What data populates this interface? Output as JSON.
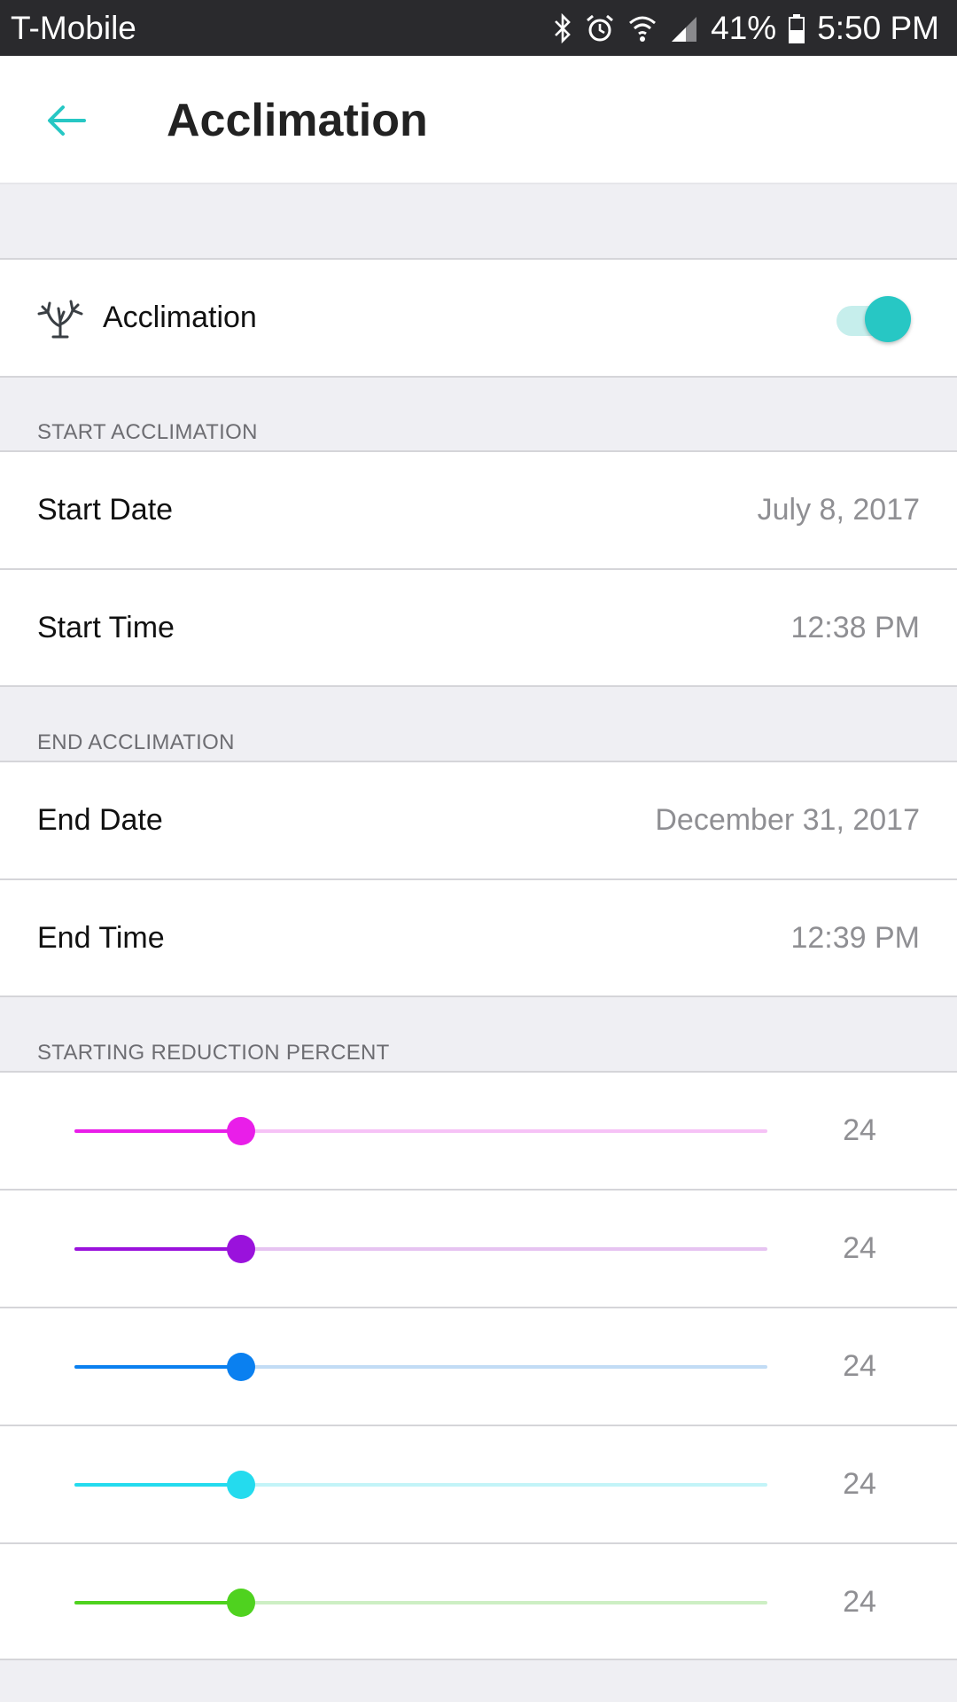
{
  "status_bar": {
    "carrier": "T-Mobile",
    "battery": "41%",
    "time": "5:50 PM",
    "icons": [
      "bluetooth-icon",
      "alarm-icon",
      "wifi-icon",
      "signal-icon",
      "battery-icon"
    ]
  },
  "header": {
    "title": "Acclimation",
    "back_icon": "back-arrow-icon",
    "accent": "#27c7c4"
  },
  "acclimation_toggle": {
    "label": "Acclimation",
    "icon": "coral-icon",
    "enabled": true
  },
  "start_section": {
    "header": "START ACCLIMATION",
    "date_label": "Start Date",
    "date_value": "July 8, 2017",
    "time_label": "Start Time",
    "time_value": "12:38 PM"
  },
  "end_section": {
    "header": "END ACCLIMATION",
    "date_label": "End Date",
    "date_value": "December 31, 2017",
    "time_label": "End Time",
    "time_value": "12:39 PM"
  },
  "reduction_section": {
    "header": "STARTING REDUCTION PERCENT",
    "sliders": [
      {
        "value": "24",
        "fraction": 0.24,
        "color": "#e91ee9",
        "track_color": "#f6c2f6"
      },
      {
        "value": "24",
        "fraction": 0.24,
        "color": "#9a12dc",
        "track_color": "#e6c3f1"
      },
      {
        "value": "24",
        "fraction": 0.24,
        "color": "#0a80f0",
        "track_color": "#c2dcf5"
      },
      {
        "value": "24",
        "fraction": 0.24,
        "color": "#24dbee",
        "track_color": "#c3f4f8"
      },
      {
        "value": "24",
        "fraction": 0.24,
        "color": "#4fd21f",
        "track_color": "#cdefc4"
      }
    ]
  }
}
